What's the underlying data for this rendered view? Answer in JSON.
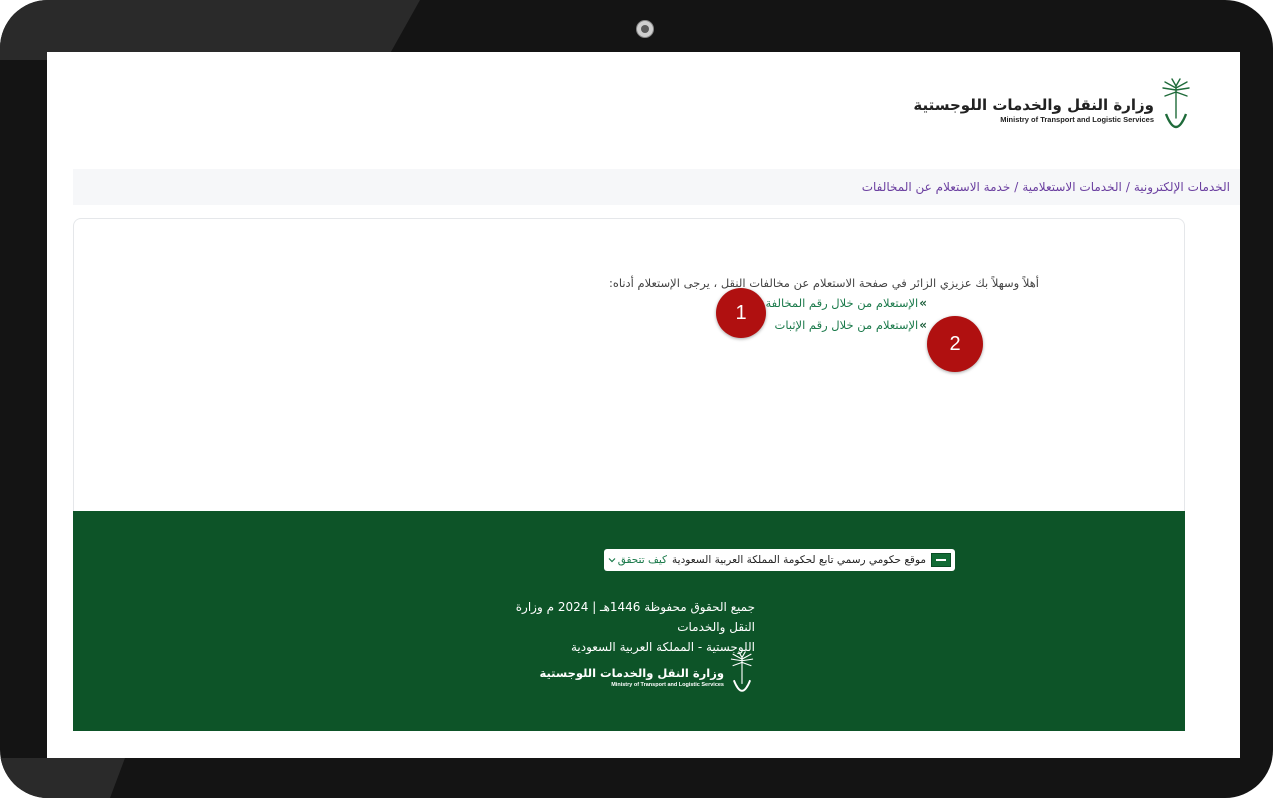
{
  "header": {
    "logo_ar": "وزارة النقل والخدمات اللوجستية",
    "logo_en": "Ministry of Transport and Logistic Services"
  },
  "breadcrumb": {
    "items": [
      "الخدمات الإلكترونية",
      "الخدمات الاستعلامية",
      "خدمة الاستعلام عن المخالفات"
    ],
    "separator": "/"
  },
  "main": {
    "intro": "أهلاً وسهلاً بك عزيزي الزائر في صفحة الاستعلام عن مخالفات النقل ، يرجى الإستعلام أدناه:",
    "links": [
      {
        "label": "الإستعلام من خلال رقم المخالفة"
      },
      {
        "label": "الإستعلام من خلال رقم الإثبات"
      }
    ],
    "markers": [
      "1",
      "2"
    ]
  },
  "footer": {
    "gov_badge": "موقع حكومي رسمي تابع لحكومة المملكة العربية السعودية",
    "verify_link": "كيف تتحقق",
    "copyright_line1": "جميع الحقوق محفوظة 1446هـ | 2024 م وزارة النقل والخدمات",
    "copyright_line2": "اللوجستية - المملكة العربية السعودية",
    "logo_ar": "وزارة النقل والخدمات اللوجستية",
    "logo_en": "Ministry of Transport and Logistic Services"
  },
  "colors": {
    "footer_bg": "#0d5428",
    "link": "#1b7a4b",
    "breadcrumb": "#6b3fa0",
    "marker": "#b01010"
  },
  "icons": [
    "palm-swords-logo-icon",
    "chevron-double-left-icon",
    "saudi-flag-icon",
    "chevron-down-icon"
  ]
}
